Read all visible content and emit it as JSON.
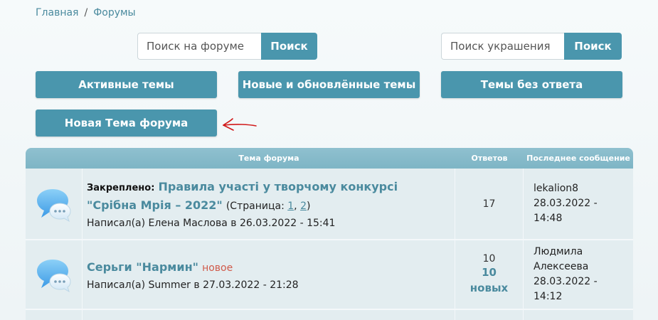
{
  "breadcrumb": {
    "home": "Главная",
    "separator": "/",
    "forums": "Форумы"
  },
  "forum_search": {
    "placeholder": "Поиск на форуме",
    "button": "Поиск"
  },
  "jewel_search": {
    "placeholder": "Поиск украшения",
    "button": "Поиск"
  },
  "actions": {
    "active": "Активные темы",
    "new_updated": "Новые и обновлённые темы",
    "unanswered": "Темы без ответа",
    "new_topic": "Новая Тема форума"
  },
  "annotation": {
    "color": "#d11a1a"
  },
  "table": {
    "headers": {
      "topic": "Тема форума",
      "replies": "Ответов",
      "last": "Последнее сообщение"
    },
    "rows": [
      {
        "icon": "chat-bubble-icon",
        "pinned_label": "Закреплено:",
        "title": "Правила участі у творчому конкурсі \"Срібна Мрія – 2022\"",
        "pages_prefix": "(Страница:",
        "page1": "1",
        "page_sep": ",",
        "page2": "2",
        "pages_suffix": ")",
        "author": "Написал(а) Елена Маслова в 26.03.2022 - 15:41",
        "replies": "17",
        "last_user": "lekalion8",
        "last_date": "28.03.2022 -",
        "last_time": "14:48"
      },
      {
        "icon": "chat-bubble-icon",
        "title": "Серьги \"Нармин\"",
        "new_tag": "новое",
        "author": "Написал(а) Summer в 27.03.2022 - 21:28",
        "replies": "10",
        "new_count": "10",
        "new_label": "новых",
        "last_user_line1": "Людмила",
        "last_user_line2": "Алексеева",
        "last_date": "28.03.2022 - 14:12"
      }
    ]
  },
  "colors": {
    "accent": "#4a96ad",
    "link": "#4a8a9e",
    "new_tag": "#d05a4a",
    "header": "#8fc0cf"
  }
}
